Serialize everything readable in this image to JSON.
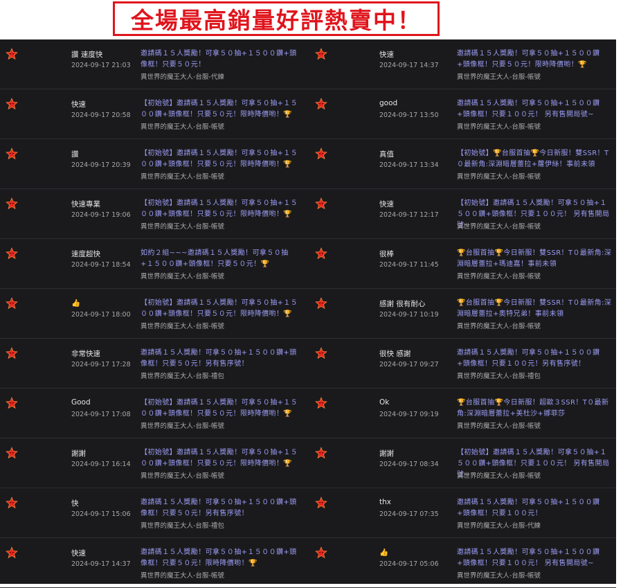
{
  "banner": {
    "text": "全場最高銷量好評熱賣中！"
  },
  "left_reviews": [
    {
      "msg": "讚 速度快",
      "date": "2024-09-17 21:03",
      "desc": "邀請碼１５人獎勵！可拿５０抽+１５００鑽+頭像框！只要５０元！",
      "item": "異世界的魔王大人-台服-代練"
    },
    {
      "msg": "快速",
      "date": "2024-09-17 20:58",
      "desc": "【初始號】邀請碼１５人獎勵！可拿５０抽+１５００鑽+頭像框！只要５０元！限時降價喲！🏆",
      "item": "異世界的魔王大人-台服-帳號"
    },
    {
      "msg": "讚",
      "date": "2024-09-17 20:39",
      "desc": "【初始號】邀請碼１５人獎勵！可拿５０抽+１５００鑽+頭像框！只要５０元！限時降價喲！🏆",
      "item": "異世界的魔王大人-台服-帳號"
    },
    {
      "msg": "快速專業",
      "date": "2024-09-17 19:06",
      "desc": "【初始號】邀請碼１５人獎勵！可拿５０抽+１５００鑽+頭像框！只要５０元！限時降價喲！🏆",
      "item": "異世界的魔王大人-台服-帳號"
    },
    {
      "msg": "速度超快",
      "date": "2024-09-17 18:54",
      "desc": "如約２組~~~邀請碼１５人獎勵！可拿５０抽+１５００鑽+頭像框！只要５０元！🏆",
      "item": "異世界的魔王大人-台服-帳號"
    },
    {
      "msg": "👍",
      "date": "2024-09-17 18:00",
      "desc": "【初始號】邀請碼１５人獎勵！可拿５０抽+１５００鑽+頭像框！只要５０元！限時降價喲！🏆",
      "item": "異世界的魔王大人-台服-帳號"
    },
    {
      "msg": "非常快速",
      "date": "2024-09-17 17:28",
      "desc": "邀請碼１５人獎勵！可拿５０抽+１５００鑽+頭像框！只要５０元！另有售序號！",
      "item": "異世界的魔王大人-台服-禮包"
    },
    {
      "msg": "Good",
      "date": "2024-09-17 17:08",
      "desc": "【初始號】邀請碼１５人獎勵！可拿５０抽+１５００鑽+頭像框！只要５０元！限時降價喲！🏆",
      "item": "異世界的魔王大人-台服-帳號"
    },
    {
      "msg": "謝謝",
      "date": "2024-09-17 16:14",
      "desc": "【初始號】邀請碼１５人獎勵！可拿５０抽+１５００鑽+頭像框！只要５０元！限時降價喲！🏆",
      "item": "異世界的魔王大人-台服-帳號"
    },
    {
      "msg": "快",
      "date": "2024-09-17 15:06",
      "desc": "邀請碼１５人獎勵！可拿５０抽+１５００鑽+頭像框！只要５０元！另有售序號！",
      "item": "異世界的魔王大人-台服-禮包"
    },
    {
      "msg": "快速",
      "date": "2024-09-17 14:37",
      "desc": "邀請碼１５人獎勵！可拿５０抽+１５００鑽+頭像框！只要５０元！限時降價喲！🏆",
      "item": "異世界的魔王大人-台服-帳號"
    }
  ],
  "right_reviews": [
    {
      "msg": "快速",
      "date": "2024-09-17 14:37",
      "desc": "邀請碼１５人獎勵！可拿５０抽+１５００鑽+頭像框！只要５０元！限時降價喲！🏆",
      "item": "異世界的魔王大人-台服-帳號"
    },
    {
      "msg": "good",
      "date": "2024-09-17 13:50",
      "desc": "邀請碼１５人獎勵！可拿５０抽+１５００鑽+頭像框！只要１００元！ 另有售開局號~",
      "item": "異世界的魔王大人-台服-帳號"
    },
    {
      "msg": "真值",
      "date": "2024-09-17 13:34",
      "desc": "【初始號】🏆台服首抽🏆今日新服！雙SSR！T０最新角:深淵暗層蕾拉+蘿伊絲！事前未領",
      "item": "異世界的魔王大人-台服-帳號"
    },
    {
      "msg": "快速",
      "date": "2024-09-17 12:17",
      "desc": "【初始號】邀請碼１５人獎勵！可拿５０抽+１５００鑽+頭像框！只要１００元！ 另有售開局號~",
      "item": "異世界的魔王大人-台服-帳號"
    },
    {
      "msg": "很棒",
      "date": "2024-09-17 11:45",
      "desc": "🏆台服首抽🏆今日新服！雙SSR！T０最新角:深淵暗層蕾拉+瑪迪嘉！事前未領",
      "item": "異世界的魔王大人-台服-帳號"
    },
    {
      "msg": "感謝 很有耐心",
      "date": "2024-09-17 10:19",
      "desc": "🏆台服首抽🏆今日新服！雙SSR！T０最新角:深淵暗層蕾拉+奧特兄弟！事前未領",
      "item": "異世界的魔王大人-台服-帳號"
    },
    {
      "msg": "很快 感謝",
      "date": "2024-09-17 09:27",
      "desc": "邀請碼１５人獎勵！可拿５０抽+１５００鑽+頭像框！只要１００元！另有售序號！",
      "item": "異世界的魔王大人-台服-禮包"
    },
    {
      "msg": "Ok",
      "date": "2024-09-17 09:19",
      "desc": "🏆台服首抽🏆今日新服！超歐３SSR！T０最新角:深淵暗層蕾拉+美杜沙+娜菲莎",
      "item": "異世界的魔王大人-台服-帳號"
    },
    {
      "msg": "謝謝",
      "date": "2024-09-17 08:34",
      "desc": "【初始號】邀請碼１５人獎勵！可拿５０抽+１５００鑽+頭像框！只要１００元！ 另有售開局號~",
      "item": "異世界的魔王大人-台服-帳號"
    },
    {
      "msg": "thx",
      "date": "2024-09-17 07:35",
      "desc": "邀請碼１５人獎勵！可拿５０抽+１５００鑽+頭像框！只要１００元！",
      "item": "異世界的魔王大人-台服-代練"
    },
    {
      "msg": "👍",
      "date": "2024-09-17 05:06",
      "desc": "邀請碼１５人獎勵！可拿５０抽+１５００鑽+頭像框！只要１００元！ 另有售開局號~",
      "item": "異世界的魔王大人-台服-帳號"
    }
  ],
  "colors": {
    "panel_bg": "#1a1a1c",
    "desc_text": "#9c9cf6",
    "star": "#e8251e",
    "banner": "#e0141c"
  },
  "icon": "red-star-rating-icon"
}
